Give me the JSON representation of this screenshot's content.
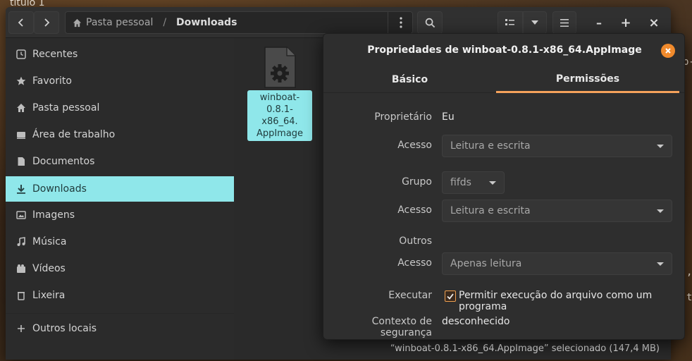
{
  "desktop": {
    "bg_title": "título 1",
    "bg_fragments": [
      "p-",
      ",",
      "t"
    ]
  },
  "window": {
    "path": {
      "home": "Pasta pessoal",
      "current": "Downloads"
    },
    "controls": {
      "minimize": "–",
      "maximize": "+",
      "close": "×"
    }
  },
  "sidebar": {
    "items": [
      {
        "label": "Recentes",
        "icon": "clock-icon"
      },
      {
        "label": "Favorito",
        "icon": "star-icon"
      },
      {
        "label": "Pasta pessoal",
        "icon": "home-icon"
      },
      {
        "label": "Área de trabalho",
        "icon": "desktop-icon"
      },
      {
        "label": "Documentos",
        "icon": "document-icon"
      },
      {
        "label": "Downloads",
        "icon": "download-icon",
        "active": true
      },
      {
        "label": "Imagens",
        "icon": "image-icon"
      },
      {
        "label": "Música",
        "icon": "music-icon"
      },
      {
        "label": "Vídeos",
        "icon": "video-icon"
      },
      {
        "label": "Lixeira",
        "icon": "trash-icon"
      },
      {
        "label": "Outros locais",
        "icon": "plus-icon"
      }
    ]
  },
  "content": {
    "file": {
      "label_line1": "winboat-0.8.1-",
      "label_line2": "x86_64.",
      "label_line3": "AppImage",
      "icon": "executable-gear-icon"
    },
    "status": "“winboat-0.8.1-x86_64.AppImage” selecionado  (147,4 MB)"
  },
  "dialog": {
    "title": "Propriedades de winboat-0.8.1-x86_64.AppImage",
    "tabs": {
      "basic": "Básico",
      "permissions": "Permissões"
    },
    "owner_label": "Proprietário",
    "owner_value": "Eu",
    "owner_access_label": "Acesso",
    "owner_access_value": "Leitura e escrita",
    "group_label": "Grupo",
    "group_value": "fifds",
    "group_access_label": "Acesso",
    "group_access_value": "Leitura e escrita",
    "others_label": "Outros",
    "others_access_label": "Acesso",
    "others_access_value": "Apenas leitura",
    "execute_label": "Executar",
    "execute_checkbox_label": "Permitir execução do arquivo como um programa",
    "execute_checked": true,
    "security_label": "Contexto de segurança",
    "security_value": "desconhecido"
  },
  "colors": {
    "accent": "#8fe7ea",
    "tab_underline": "#f5a25b",
    "close_button": "#f08a2c"
  }
}
